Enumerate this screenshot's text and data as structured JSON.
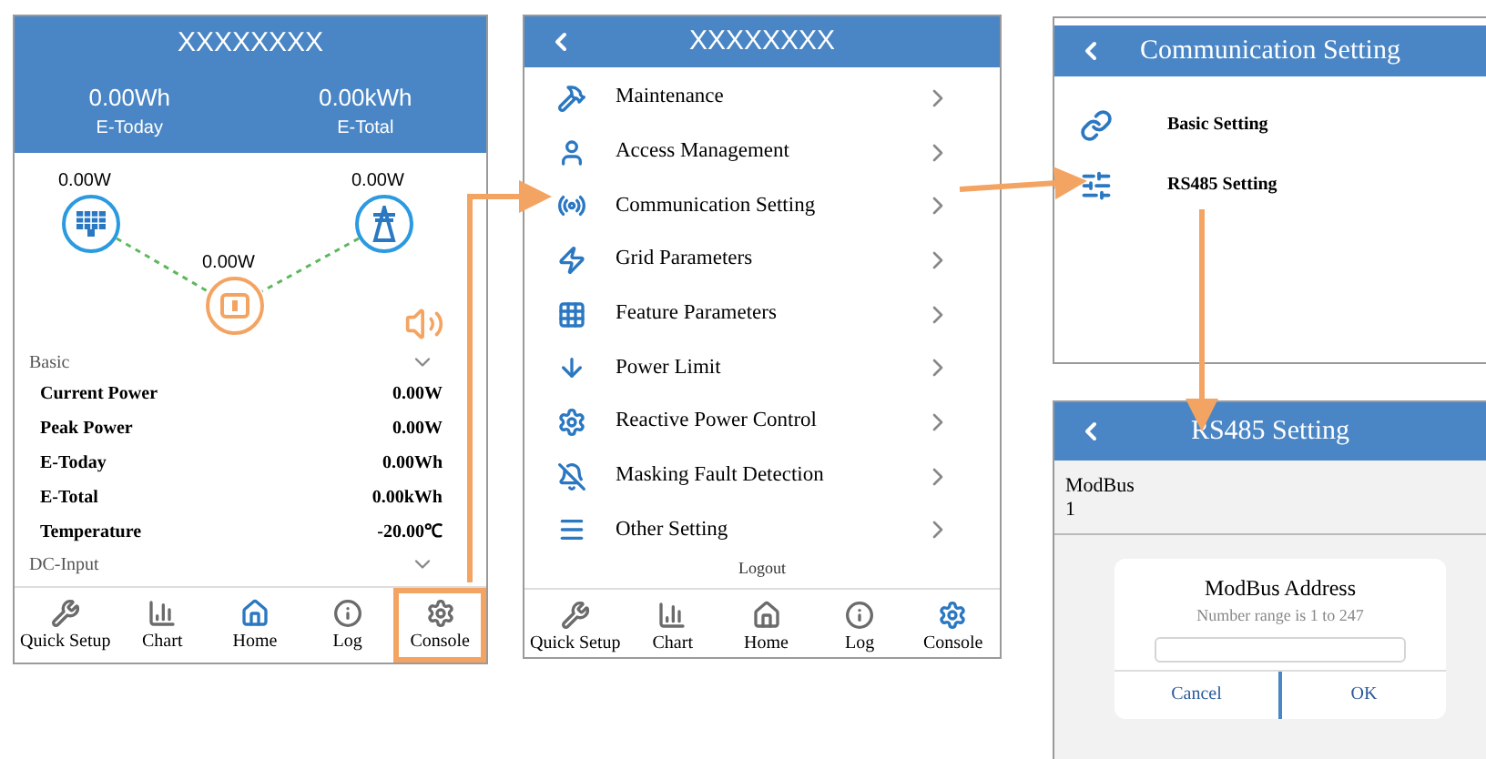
{
  "home_screen": {
    "title": "XXXXXXXX",
    "summary": [
      {
        "value": "0.00Wh",
        "label": "E-Today"
      },
      {
        "value": "0.00kWh",
        "label": "E-Total"
      }
    ],
    "flow": {
      "pv": "0.00W",
      "grid": "0.00W",
      "inverter": "0.00W"
    },
    "sections": [
      {
        "title": "Basic",
        "rows": [
          {
            "label": "Current Power",
            "value": "0.00W"
          },
          {
            "label": "Peak Power",
            "value": "0.00W"
          },
          {
            "label": "E-Today",
            "value": "0.00Wh"
          },
          {
            "label": "E-Total",
            "value": "0.00kWh"
          },
          {
            "label": "Temperature",
            "value": "-20.00℃"
          }
        ]
      },
      {
        "title": "DC-Input"
      }
    ],
    "nav": [
      {
        "kind": "quick_setup",
        "label": "Quick Setup",
        "selected": false,
        "highlighted": false
      },
      {
        "kind": "chart",
        "label": "Chart",
        "selected": false,
        "highlighted": false
      },
      {
        "kind": "home",
        "label": "Home",
        "selected": true,
        "highlighted": false
      },
      {
        "kind": "log",
        "label": "Log",
        "selected": false,
        "highlighted": false
      },
      {
        "kind": "console",
        "label": "Console",
        "selected": false,
        "highlighted": true
      }
    ]
  },
  "console_screen": {
    "title": "XXXXXXXX",
    "menu": [
      {
        "kind": "maintenance",
        "label": "Maintenance"
      },
      {
        "kind": "access",
        "label": "Access Management"
      },
      {
        "kind": "communication",
        "label": "Communication Setting"
      },
      {
        "kind": "grid",
        "label": "Grid Parameters"
      },
      {
        "kind": "feature",
        "label": "Feature Parameters"
      },
      {
        "kind": "power_limit",
        "label": "Power Limit"
      },
      {
        "kind": "reactive",
        "label": "Reactive Power Control"
      },
      {
        "kind": "masking",
        "label": "Masking Fault Detection"
      },
      {
        "kind": "other",
        "label": "Other Setting"
      }
    ],
    "footer": "Logout",
    "nav": [
      {
        "kind": "quick_setup",
        "label": "Quick Setup",
        "selected": false,
        "highlighted": false
      },
      {
        "kind": "chart",
        "label": "Chart",
        "selected": false,
        "highlighted": false
      },
      {
        "kind": "home",
        "label": "Home",
        "selected": false,
        "highlighted": false
      },
      {
        "kind": "log",
        "label": "Log",
        "selected": false,
        "highlighted": false
      },
      {
        "kind": "console",
        "label": "Console",
        "selected": true,
        "highlighted": false
      }
    ]
  },
  "communication_screen": {
    "title": "Communication Setting",
    "items": [
      {
        "kind": "basic",
        "label": "Basic Setting"
      },
      {
        "kind": "rs485",
        "label": "RS485 Setting"
      }
    ]
  },
  "rs485_screen": {
    "title": "RS485 Setting",
    "field": {
      "label": "ModBus",
      "value": "1"
    },
    "dialog": {
      "title": "ModBus Address",
      "hint": "Number range is 1 to 247",
      "buttons": [
        "Cancel",
        "OK"
      ]
    }
  }
}
